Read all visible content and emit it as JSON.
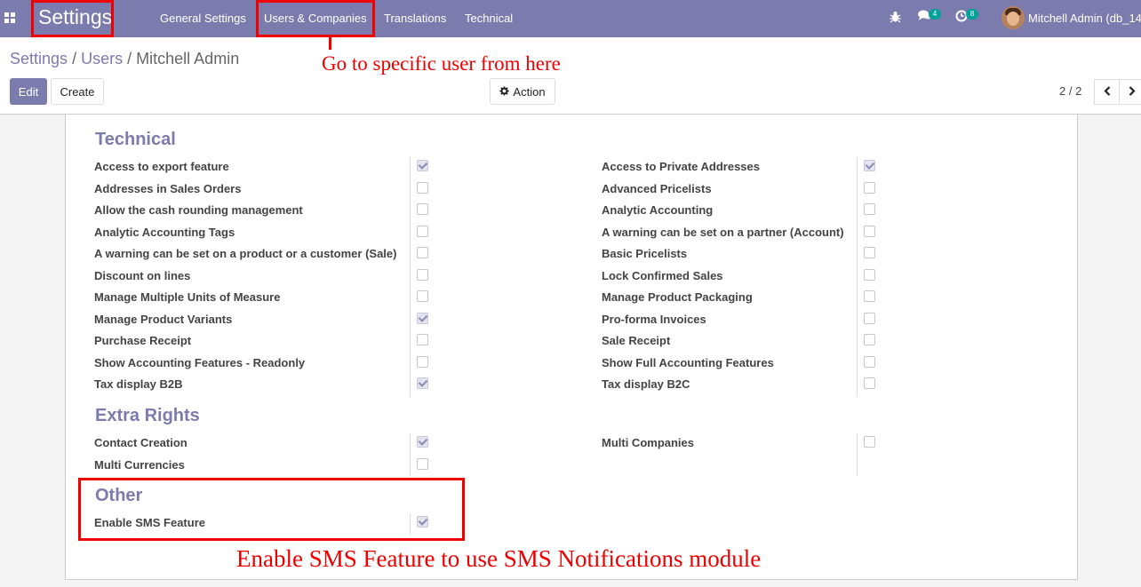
{
  "navbar": {
    "brand": "Settings",
    "menu": [
      "General Settings",
      "Users & Companies",
      "Translations",
      "Technical"
    ],
    "chat_badge": "4",
    "activity_badge": "8",
    "user": "Mitchell Admin (db_14"
  },
  "breadcrumb": {
    "root": "Settings",
    "sep1": "/",
    "middle": "Users",
    "sep2": "/",
    "current": "Mitchell Admin"
  },
  "buttons": {
    "edit": "Edit",
    "create": "Create",
    "action": "Action"
  },
  "pager": {
    "value": "2 / 2"
  },
  "annotations": {
    "top": "Go to specific user from here",
    "bottom": "Enable SMS Feature to use SMS Notifications module"
  },
  "groups": {
    "technical": {
      "title": "Technical",
      "left": [
        {
          "label": "Access to export feature",
          "checked": true
        },
        {
          "label": "Addresses in Sales Orders",
          "checked": false
        },
        {
          "label": "Allow the cash rounding management",
          "checked": false
        },
        {
          "label": "Analytic Accounting Tags",
          "checked": false
        },
        {
          "label": "A warning can be set on a product or a customer (Sale)",
          "checked": false
        },
        {
          "label": "Discount on lines",
          "checked": false
        },
        {
          "label": "Manage Multiple Units of Measure",
          "checked": false
        },
        {
          "label": "Manage Product Variants",
          "checked": true
        },
        {
          "label": "Purchase Receipt",
          "checked": false
        },
        {
          "label": "Show Accounting Features - Readonly",
          "checked": false
        },
        {
          "label": "Tax display B2B",
          "checked": true
        }
      ],
      "right": [
        {
          "label": "Access to Private Addresses",
          "checked": true
        },
        {
          "label": "Advanced Pricelists",
          "checked": false
        },
        {
          "label": "Analytic Accounting",
          "checked": false
        },
        {
          "label": "A warning can be set on a partner (Account)",
          "checked": false
        },
        {
          "label": "Basic Pricelists",
          "checked": false
        },
        {
          "label": "Lock Confirmed Sales",
          "checked": false
        },
        {
          "label": "Manage Product Packaging",
          "checked": false
        },
        {
          "label": "Pro-forma Invoices",
          "checked": false
        },
        {
          "label": "Sale Receipt",
          "checked": false
        },
        {
          "label": "Show Full Accounting Features",
          "checked": false
        },
        {
          "label": "Tax display B2C",
          "checked": false
        }
      ]
    },
    "extra": {
      "title": "Extra Rights",
      "left": [
        {
          "label": "Contact Creation",
          "checked": true
        },
        {
          "label": "Multi Currencies",
          "checked": false
        }
      ],
      "right": [
        {
          "label": "Multi Companies",
          "checked": false
        }
      ]
    },
    "other": {
      "title": "Other",
      "left": [
        {
          "label": "Enable SMS Feature",
          "checked": true
        }
      ]
    }
  }
}
